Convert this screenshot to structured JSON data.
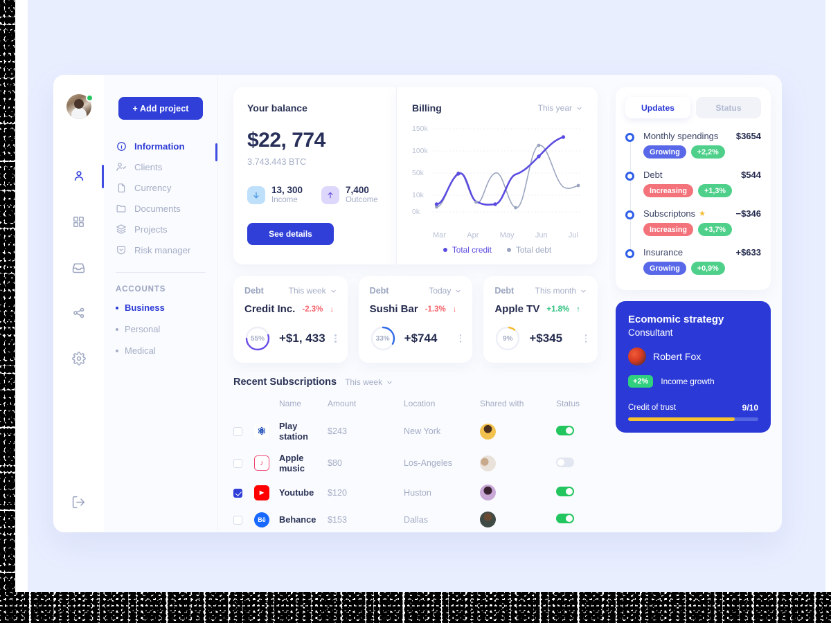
{
  "rail": {
    "avatar_name": "user-avatar",
    "items": [
      {
        "name": "profile",
        "icon": "person-icon",
        "active": true
      },
      {
        "name": "dashboard",
        "icon": "grid-icon",
        "active": false
      },
      {
        "name": "inbox",
        "icon": "inbox-icon",
        "active": false
      },
      {
        "name": "share",
        "icon": "share-icon",
        "active": false
      },
      {
        "name": "settings",
        "icon": "gear-icon",
        "active": false
      }
    ],
    "logout_icon": "logout-icon"
  },
  "sidebar": {
    "add_project_label": "+ Add project",
    "items": [
      {
        "label": "Information",
        "icon": "info-icon",
        "active": true
      },
      {
        "label": "Clients",
        "icon": "user-check-icon",
        "active": false
      },
      {
        "label": "Currency",
        "icon": "file-icon",
        "active": false
      },
      {
        "label": "Documents",
        "icon": "folder-icon",
        "active": false
      },
      {
        "label": "Projects",
        "icon": "layers-icon",
        "active": false
      },
      {
        "label": "Risk manager",
        "icon": "shield-icon",
        "active": false
      }
    ],
    "accounts_label": "ACCOUNTS",
    "accounts": [
      {
        "label": "Business",
        "active": true
      },
      {
        "label": "Personal",
        "active": false
      },
      {
        "label": "Medical",
        "active": false
      }
    ]
  },
  "balance": {
    "title": "Your balance",
    "amount": "$22, 774",
    "btc": "3.743.443 BTC",
    "income": {
      "value": "13, 300",
      "label": "Income",
      "icon": "arrow-down-icon"
    },
    "outcome": {
      "value": "7,400",
      "label": "Outcome",
      "icon": "arrow-up-icon"
    },
    "button": "See details"
  },
  "billing": {
    "title": "Billing",
    "range": "This year",
    "legend": [
      {
        "label": "Total credit",
        "color": "#5b4ce0"
      },
      {
        "label": "Total debt",
        "color": "#9aa4bf"
      }
    ]
  },
  "chart_data": {
    "type": "line",
    "title": "Billing",
    "x": [
      "Mar",
      "Apr",
      "May",
      "Jun",
      "Jul"
    ],
    "ytick_labels": [
      "0k",
      "10k",
      "50k",
      "100k",
      "150k"
    ],
    "xlabel": "",
    "ylabel": "",
    "ylim": [
      0,
      150
    ],
    "grid": true,
    "legend_position": "bottom",
    "series": [
      {
        "name": "Total credit",
        "color": "#5b4ce0",
        "values": [
          5,
          45,
          8,
          50,
          100
        ]
      },
      {
        "name": "Total debt",
        "color": "#9aa4bf",
        "values": [
          0,
          48,
          3,
          92,
          22
        ]
      }
    ]
  },
  "debt_cards": [
    {
      "label": "Debt",
      "range": "This week",
      "name": "Credit Inc.",
      "pct": "-2.3%",
      "dir": "down",
      "ring_pct": 55,
      "ring_label": "55%",
      "ring_color": "#6b4ce8",
      "amount": "+$1, 433"
    },
    {
      "label": "Debt",
      "range": "Today",
      "name": "Sushi Bar",
      "pct": "-1.3%",
      "dir": "down",
      "ring_pct": 33,
      "ring_label": "33%",
      "ring_color": "#2f6ae8",
      "amount": "+$744"
    },
    {
      "label": "Debt",
      "range": "This month",
      "name": "Apple TV",
      "pct": "+1.8%",
      "dir": "up",
      "ring_pct": 9,
      "ring_label": "9%",
      "ring_color": "#f6bb2e",
      "amount": "+$345"
    }
  ],
  "subscriptions": {
    "title": "Recent Subscriptions",
    "range": "This week",
    "columns": [
      "Name",
      "Amount",
      "Location",
      "Shared with",
      "Status"
    ],
    "rows": [
      {
        "checked": false,
        "brand": "playstation-icon",
        "brand_bg": "#ffffff",
        "brand_fg": "#0b3fb0",
        "brand_text": "P",
        "name": "Play station",
        "amount": "$243",
        "location": "New York",
        "avatar": "avatar-woman-yellow",
        "status": true
      },
      {
        "checked": false,
        "brand": "apple-music-icon",
        "brand_bg": "#ffffff",
        "brand_fg": "#f0436f",
        "brand_text": "♪",
        "name": "Apple music",
        "amount": "$80",
        "location": "Los-Angeles",
        "avatar": "avatar-group",
        "status": false
      },
      {
        "checked": true,
        "brand": "youtube-icon",
        "brand_bg": "#ff0000",
        "brand_fg": "#ffffff",
        "brand_text": "▶",
        "name": "Youtube",
        "amount": "$120",
        "location": "Huston",
        "avatar": "avatar-woman-purple",
        "status": true
      },
      {
        "checked": false,
        "brand": "behance-icon",
        "brand_bg": "#1769ff",
        "brand_fg": "#ffffff",
        "brand_text": "Bē",
        "name": "Behance",
        "amount": "$153",
        "location": "Dallas",
        "avatar": "avatar-man",
        "status": true
      }
    ]
  },
  "panel": {
    "tabs": [
      {
        "label": "Updates",
        "active": true
      },
      {
        "label": "Status",
        "active": false
      }
    ],
    "updates": [
      {
        "name": "Monthly spendings",
        "amount": "$3654",
        "star": false,
        "state": "Growing",
        "state_kind": "growing",
        "delta": "+2,2%"
      },
      {
        "name": "Debt",
        "amount": "$544",
        "star": false,
        "state": "Increasing",
        "state_kind": "increasing",
        "delta": "+1,3%"
      },
      {
        "name": "Subscriptons",
        "amount": "−$346",
        "star": true,
        "state": "Increasing",
        "state_kind": "increasing",
        "delta": "+3,7%"
      },
      {
        "name": "Insurance",
        "amount": "+$633",
        "star": false,
        "state": "Growing",
        "state_kind": "growing",
        "delta": "+0,9%"
      }
    ]
  },
  "strategy": {
    "title": "Ecomomic strategy",
    "subtitle": "Consultant",
    "person": "Robert Fox",
    "badge": "+2%",
    "growth_label": "Income growth",
    "trust_label": "Credit of trust",
    "trust_value": "9/10",
    "trust_pct": 82
  }
}
